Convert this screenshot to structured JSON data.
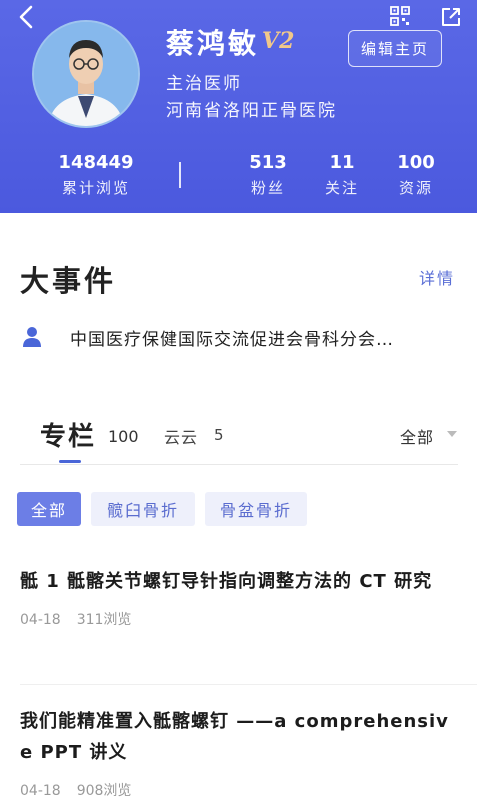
{
  "profile": {
    "name": "蔡鸿敏",
    "badge": "V2",
    "edit_label": "编辑主页",
    "title": "主治医师",
    "hospital": "河南省洛阳正骨医院"
  },
  "stats": {
    "total_views": {
      "value": "148449",
      "label": "累计浏览"
    },
    "fans": {
      "value": "513",
      "label": "粉丝"
    },
    "following": {
      "value": "11",
      "label": "关注"
    },
    "resources": {
      "value": "100",
      "label": "资源"
    }
  },
  "events": {
    "title": "大事件",
    "details_label": "详情",
    "item_text": "中国医疗保健国际交流促进会骨科分会…"
  },
  "tabs": {
    "main_label": "专栏",
    "main_count": "100",
    "second_label": "云云",
    "second_count": "5",
    "filter_label": "全部"
  },
  "chips": [
    "全部",
    "髋臼骨折",
    "骨盆骨折"
  ],
  "articles": [
    {
      "title": "骶 1 骶髂关节螺钉导针指向调整方法的 CT 研究",
      "date": "04-18",
      "views": "311浏览"
    },
    {
      "title": "我们能精准置入骶髂螺钉 ——a comprehensive PPT 讲义",
      "date": "04-18",
      "views": "908浏览"
    }
  ],
  "colors": {
    "header_bg": "#5262e2",
    "accent": "#4a66d8",
    "chip_active_bg": "#6c7ee6",
    "chip_bg": "#eef0fb",
    "badge_gold": "#f1c88a"
  },
  "icons": [
    "back-icon",
    "qr-code-icon",
    "share-icon",
    "person-icon",
    "caret-down-icon"
  ]
}
